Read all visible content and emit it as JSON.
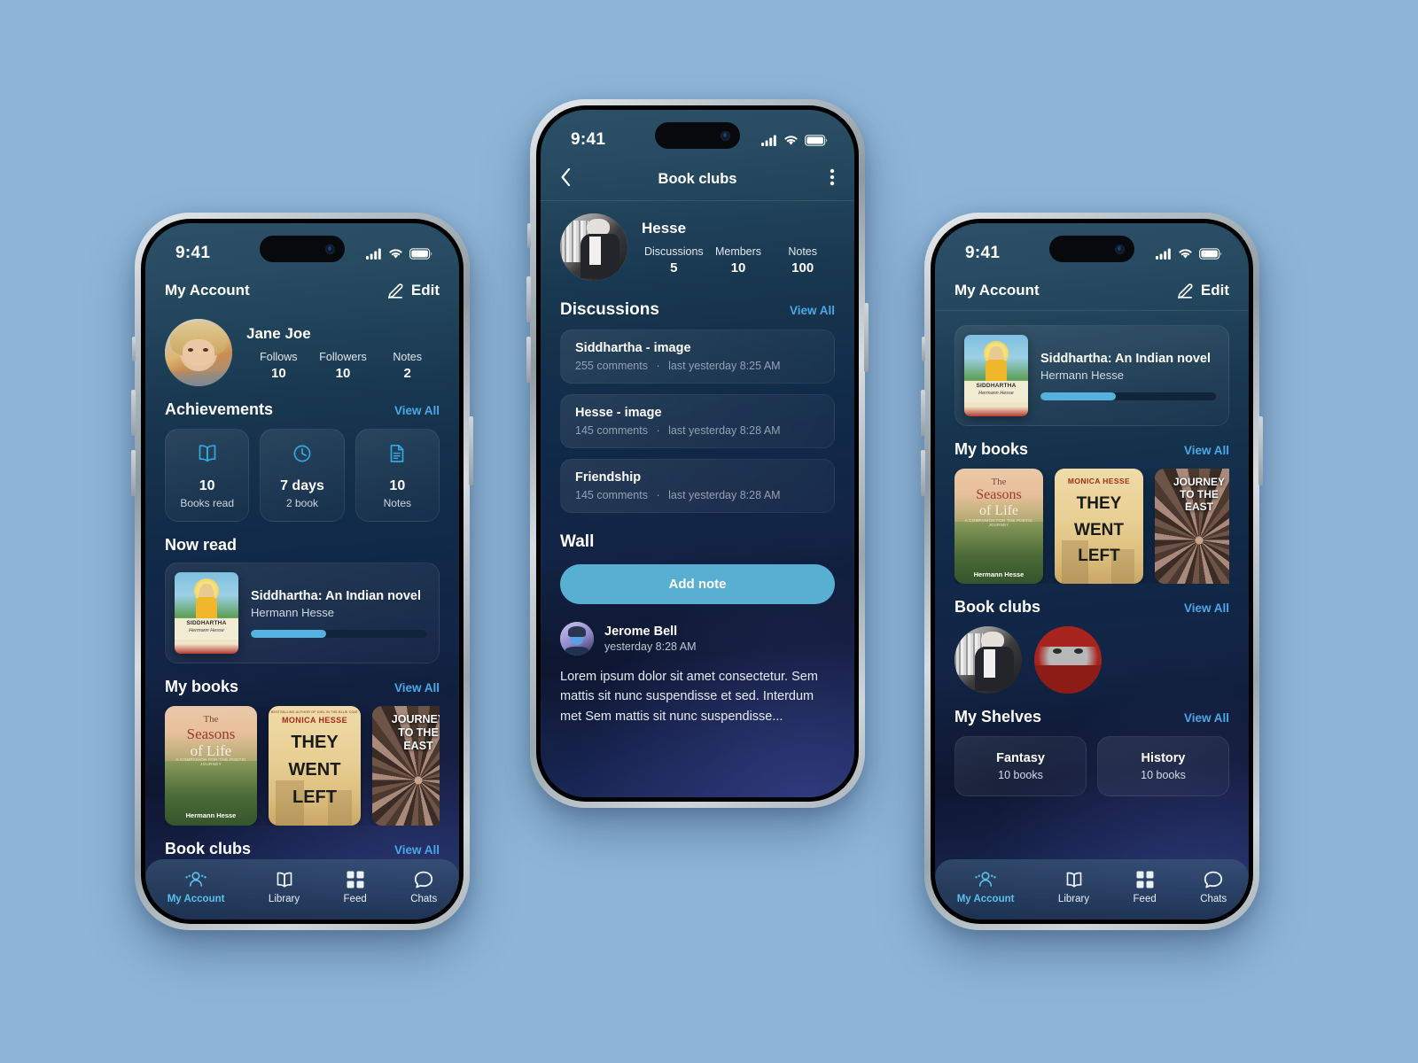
{
  "background_color": "#8fb6d8",
  "accent_color": "#49a9e8",
  "progress_color": "#54b2dd",
  "common": {
    "status_time": "9:41",
    "view_all": "View All",
    "tabs": [
      {
        "label": "My Account",
        "icon": "user-icon",
        "active": true
      },
      {
        "label": "Library",
        "icon": "book-icon",
        "active": false
      },
      {
        "label": "Feed",
        "icon": "grid-icon",
        "active": false
      },
      {
        "label": "Chats",
        "icon": "chat-icon",
        "active": false
      }
    ],
    "status_icons": [
      "cellular-signal-icon",
      "wifi-icon",
      "battery-icon"
    ]
  },
  "phone_left": {
    "appbar": {
      "title": "My Account",
      "edit_label": "Edit",
      "edit_icon": "pencil-icon"
    },
    "profile": {
      "name": "Jane Joe",
      "avatar": "user-photo-avatar",
      "stats": [
        {
          "label": "Follows",
          "value": "10"
        },
        {
          "label": "Followers",
          "value": "10"
        },
        {
          "label": "Notes",
          "value": "2"
        }
      ]
    },
    "achievements": {
      "title": "Achievements",
      "items": [
        {
          "icon": "open-book-icon",
          "value": "10",
          "sub": "Books read"
        },
        {
          "icon": "clock-icon",
          "value": "7 days",
          "sub": "2 book"
        },
        {
          "icon": "document-icon",
          "value": "10",
          "sub": "Notes"
        }
      ]
    },
    "now_read": {
      "title": "Now read",
      "book_title": "Siddhartha: An Indian novel",
      "book_author": "Hermann Hesse",
      "cover_label": "SIDDHARTHA",
      "cover_author": "Hermann Hesse",
      "progress_percent": 43
    },
    "my_books": {
      "title": "My books",
      "covers": [
        {
          "art": "art-seasons",
          "line1": "The",
          "line2": "Seasons",
          "line3": "of Life",
          "sub": "A COMPANION FOR THE POETIC JOURNEY",
          "author": "Hermann Hesse"
        },
        {
          "art": "art-they",
          "top": "BESTSELLING AUTHOR OF GIRL IN THE BLUE COAT",
          "author_top": "MONICA HESSE",
          "line1": "THEY",
          "line2": "WENT",
          "line3": "LEFT"
        },
        {
          "art": "art-journey",
          "line1": "JOURNEY",
          "line2": "TO THE",
          "line3": "EAST"
        }
      ]
    },
    "book_clubs": {
      "title": "Book clubs"
    }
  },
  "phone_center": {
    "appbar": {
      "title": "Book clubs",
      "back_icon": "chevron-left-icon",
      "menu_icon": "more-vertical-icon"
    },
    "club": {
      "name": "Hesse",
      "avatar": "hesse-photo-avatar",
      "stats": [
        {
          "label": "Discussions",
          "value": "5"
        },
        {
          "label": "Members",
          "value": "10"
        },
        {
          "label": "Notes",
          "value": "100"
        }
      ]
    },
    "discussions": {
      "title": "Discussions",
      "items": [
        {
          "title": "Siddhartha - image",
          "comments": "255 comments",
          "time": "last yesterday 8:25 AM"
        },
        {
          "title": "Hesse - image",
          "comments": "145 comments",
          "time": "last yesterday 8:28 AM"
        },
        {
          "title": "Friendship",
          "comments": "145 comments",
          "time": "last yesterday 8:28 AM"
        }
      ]
    },
    "wall": {
      "title": "Wall",
      "add_note_label": "Add note",
      "note": {
        "author": "Jerome Bell",
        "avatar": "jerome-photo-avatar",
        "time": "yesterday 8:28 AM",
        "body": "Lorem ipsum dolor sit amet consectetur. Sem mattis sit nunc suspendisse et sed. Interdum met Sem mattis sit nunc suspendisse..."
      }
    }
  },
  "phone_right": {
    "appbar": {
      "title": "My Account",
      "edit_label": "Edit",
      "edit_icon": "pencil-icon"
    },
    "now_read": {
      "book_title": "Siddhartha: An Indian novel",
      "book_author": "Hermann Hesse",
      "cover_label": "SIDDHARTHA",
      "cover_author": "Hermann Hesse",
      "progress_percent": 43
    },
    "my_books": {
      "title": "My books",
      "covers": [
        {
          "art": "art-seasons",
          "line1": "The",
          "line2": "Seasons",
          "line3": "of Life",
          "sub": "A COMPANION FOR THE POETIC JOURNEY",
          "author": "Hermann Hesse"
        },
        {
          "art": "art-they",
          "author_top": "MONICA HESSE",
          "line1": "THEY",
          "line2": "WENT",
          "line3": "LEFT"
        },
        {
          "art": "art-journey",
          "line1": "JOURNEY",
          "line2": "TO THE",
          "line3": "EAST"
        }
      ]
    },
    "book_clubs": {
      "title": "Book clubs",
      "avatars": [
        "hesse-photo-avatar",
        "red-portrait-avatar"
      ]
    },
    "my_shelves": {
      "title": "My Shelves",
      "items": [
        {
          "name": "Fantasy",
          "count": "10 books"
        },
        {
          "name": "History",
          "count": "10 books"
        }
      ]
    }
  }
}
